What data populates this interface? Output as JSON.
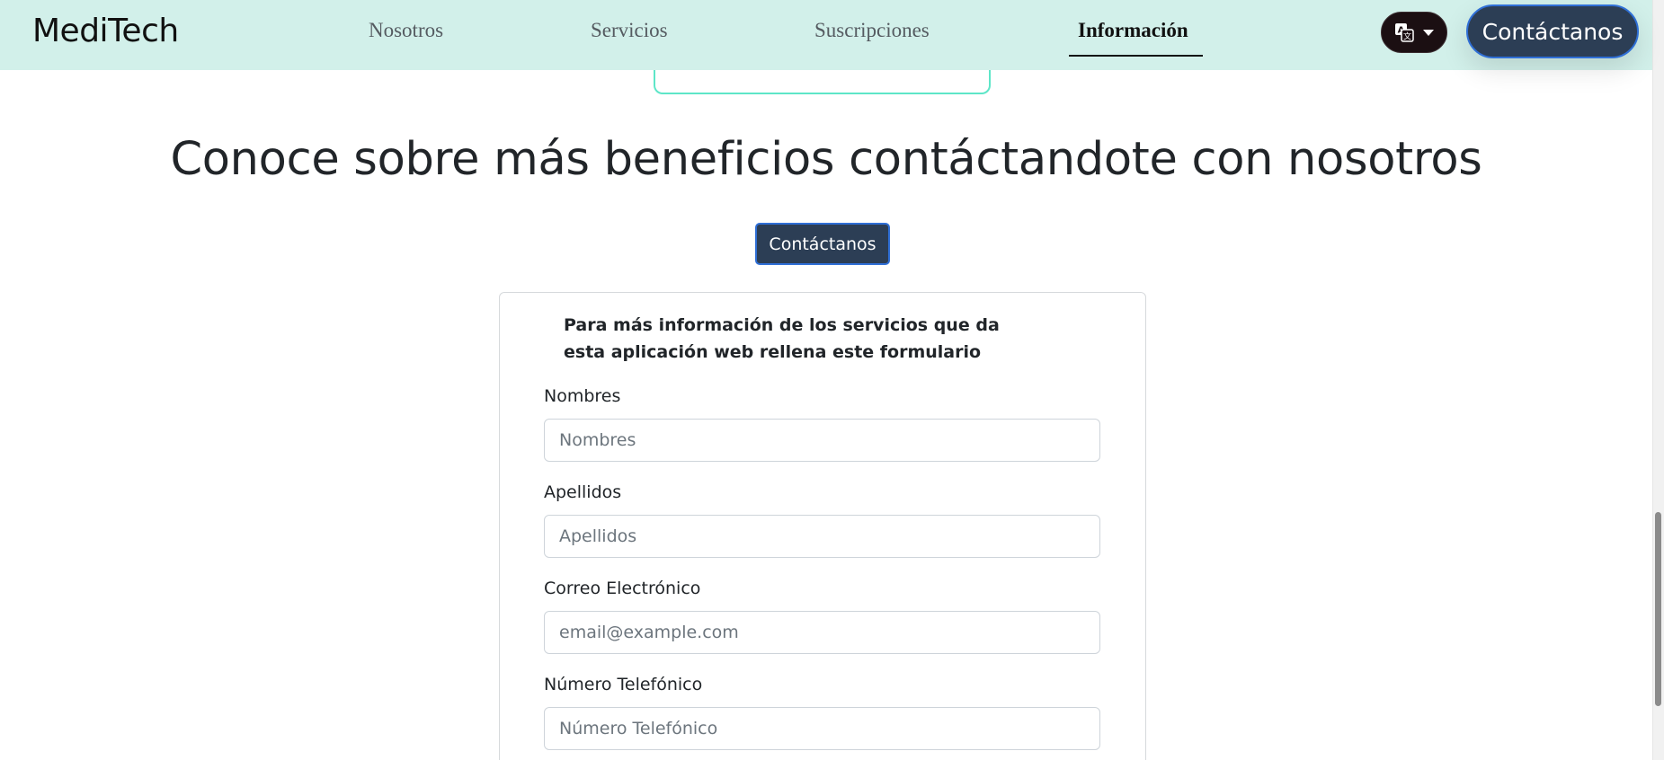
{
  "navbar": {
    "brand": "MediTech",
    "links": [
      "Nosotros",
      "Servicios",
      "Suscripciones",
      "Información"
    ],
    "active_link": "Información",
    "language_icon": "translate-icon",
    "contact_label": "Contáctanos"
  },
  "main": {
    "headline": "Conoce sobre más beneficios contáctandote con nosotros",
    "cta_label": "Contáctanos"
  },
  "form": {
    "intro": "Para más información de los servicios que da esta aplicación web rellena este formulario",
    "fields": [
      {
        "label": "Nombres",
        "placeholder": "Nombres"
      },
      {
        "label": "Apellidos",
        "placeholder": "Apellidos"
      },
      {
        "label": "Correo Electrónico",
        "placeholder": "email@example.com"
      },
      {
        "label": "Número Telefónico",
        "placeholder": "Número Telefónico"
      }
    ]
  },
  "colors": {
    "navbar_bg": "#d2f0ea",
    "button_bg": "#2c3e55",
    "button_border": "#2f6fd6",
    "card_accent": "#5ee6c8"
  }
}
